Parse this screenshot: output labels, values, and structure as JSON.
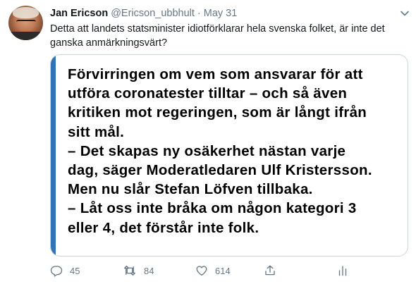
{
  "tweet": {
    "author_name": "Jan Ericson",
    "author_handle": "@Ericson_ubbhult",
    "separator": "·",
    "date": "May 31",
    "text": "Detta att landets statsminister idiotförklarar hela svenska folket, är inte det ganska anmärkningsvärt?",
    "image_text_lines": [
      "Förvirringen om vem som ansvarar för att",
      "utföra coronatester tilltar – och så även",
      "kritiken mot regeringen, som är långt ifrån",
      "sitt mål.",
      "– Det skapas ny osäkerhet nästan varje",
      "dag, säger Moderatledaren Ulf Kristersson.",
      "Men nu slår Stefan Löfven tillbaka.",
      "– Låt oss inte bråka om någon kategori 3",
      "eller 4, det förstår inte folk."
    ],
    "replies": "45",
    "retweets": "84",
    "likes": "614"
  },
  "icons": {
    "caret": "chevron-down-icon",
    "reply": "reply-icon",
    "retweet": "retweet-icon",
    "like": "heart-icon",
    "share": "share-icon",
    "analytics": "analytics-icon"
  },
  "colors": {
    "muted": "#657786",
    "quote_bar": "#2f73b8",
    "border": "#ccd6dd"
  }
}
